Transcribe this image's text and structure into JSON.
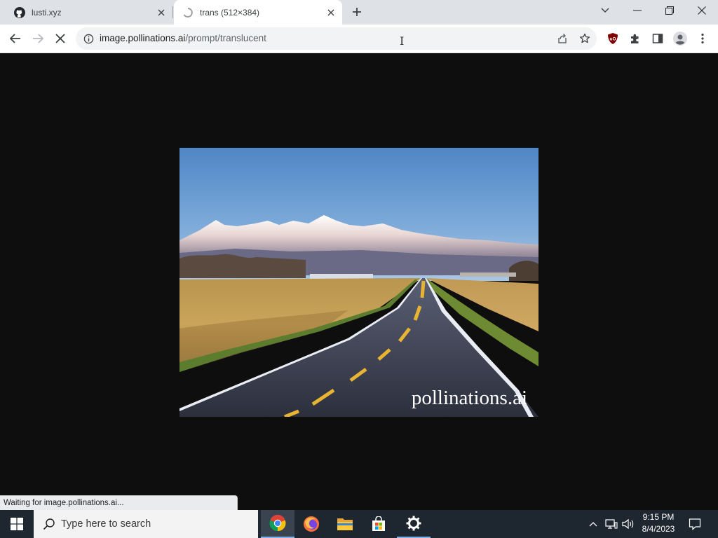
{
  "browser": {
    "tabs": [
      {
        "title": "lusti.xyz",
        "active": false,
        "icon": "github-icon"
      },
      {
        "title": "trans (512×384)",
        "active": true,
        "icon": "loading-spinner-icon"
      }
    ],
    "window_controls": [
      "chevron-down-icon",
      "minimize-icon",
      "restore-icon",
      "close-icon"
    ],
    "address": {
      "host": "image.pollinations.ai",
      "path": "/prompt/translucent"
    },
    "status": "Waiting for image.pollinations.ai..."
  },
  "page": {
    "image_watermark": "pollinations.ai",
    "colors": {
      "background": "#0e0e0f",
      "sky_top": "#4f86c6",
      "field": "#c9a45a",
      "road": "#3a3d4a"
    }
  },
  "taskbar": {
    "search_placeholder": "Type here to search",
    "apps": [
      "chrome-icon",
      "firefox-icon",
      "file-explorer-icon",
      "microsoft-store-icon",
      "settings-icon"
    ],
    "clock": {
      "time": "9:15 PM",
      "date": "8/4/2023"
    }
  }
}
